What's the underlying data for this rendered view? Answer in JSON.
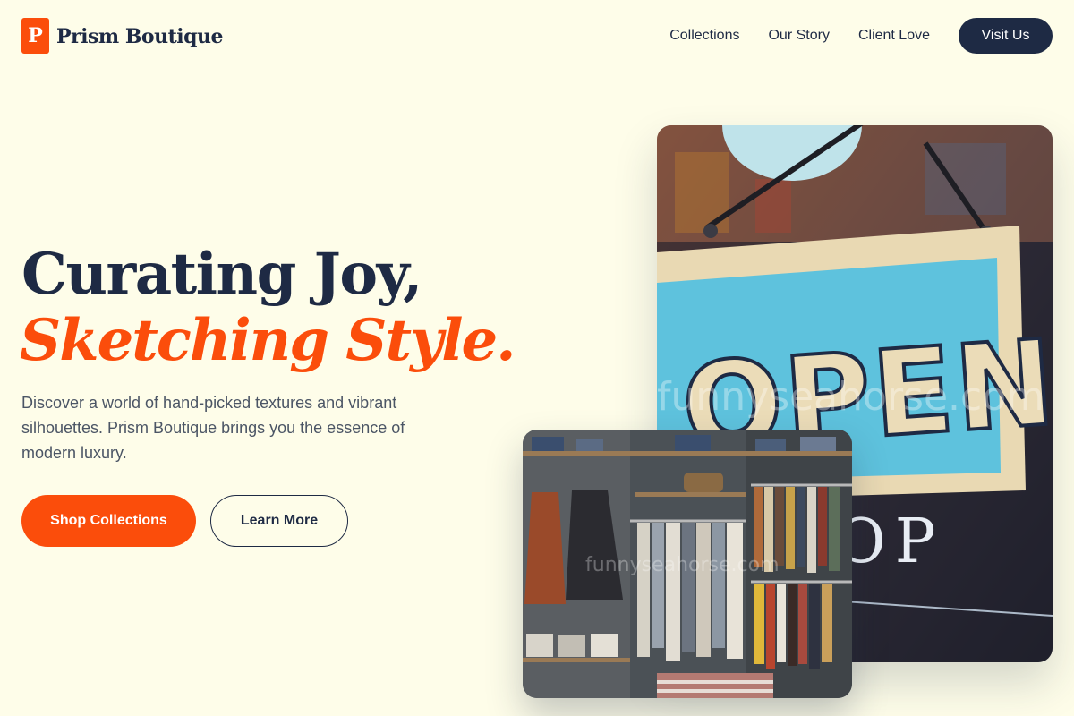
{
  "brand": {
    "mark": "P",
    "name": "Prism Boutique"
  },
  "nav": {
    "links": [
      "Collections",
      "Our Story",
      "Client Love"
    ],
    "cta": "Visit Us"
  },
  "hero": {
    "title": "Curating Joy,",
    "title_accent": "Sketching Style.",
    "description": "Discover a world of hand-picked textures and vibrant silhouettes. Prism Boutique brings you the essence of modern luxury.",
    "primary_button": "Shop Collections",
    "secondary_button": "Learn More"
  },
  "images": {
    "storefront": {
      "sign_text": "OPEN",
      "window_text": "OP",
      "watermark": "funnyseahorse.com"
    },
    "interior": {
      "watermark": "funnyseahorse.com"
    }
  },
  "colors": {
    "accent": "#fb4d0b",
    "navy": "#1e2a44",
    "background": "#fefde9",
    "body_text": "#4b5565"
  }
}
